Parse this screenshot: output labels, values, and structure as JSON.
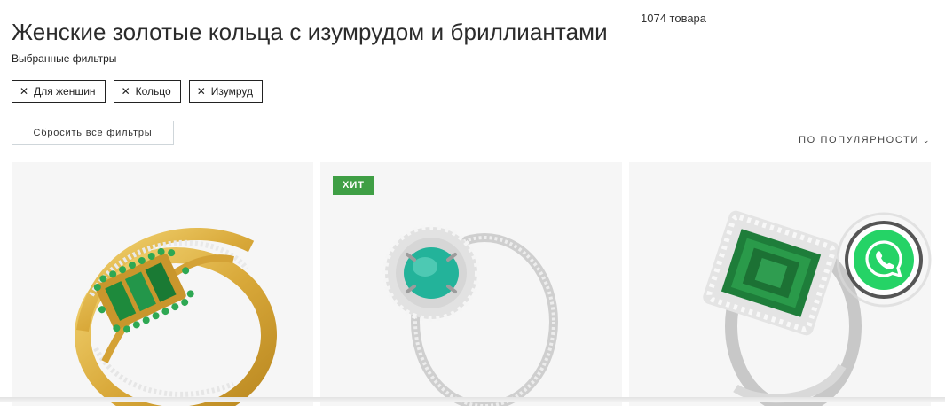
{
  "header": {
    "title": "Женские золотые кольца с изумрудом и бриллиантами",
    "count": "1074 товара"
  },
  "filters": {
    "label": "Выбранные фильтры",
    "chips": [
      {
        "label": "Для женщин"
      },
      {
        "label": "Кольцо"
      },
      {
        "label": "Изумруд"
      }
    ],
    "reset_label": "Сбросить все фильтры"
  },
  "sort": {
    "label": "ПО ПОПУЛЯРНОСТИ",
    "icon": "chevron-down-icon"
  },
  "products": [
    {
      "image": "gold-emerald-ring",
      "badge": ""
    },
    {
      "image": "white-gold-emerald-halo-ring",
      "badge": "ХИТ"
    },
    {
      "image": "white-gold-emerald-cut-ring",
      "badge": ""
    }
  ],
  "whatsapp": {
    "icon": "whatsapp-icon"
  },
  "colors": {
    "badge": "#3f9f45",
    "whatsapp": "#25d366",
    "emerald": "#1e8a3c",
    "gold": "#d9ad3c"
  }
}
